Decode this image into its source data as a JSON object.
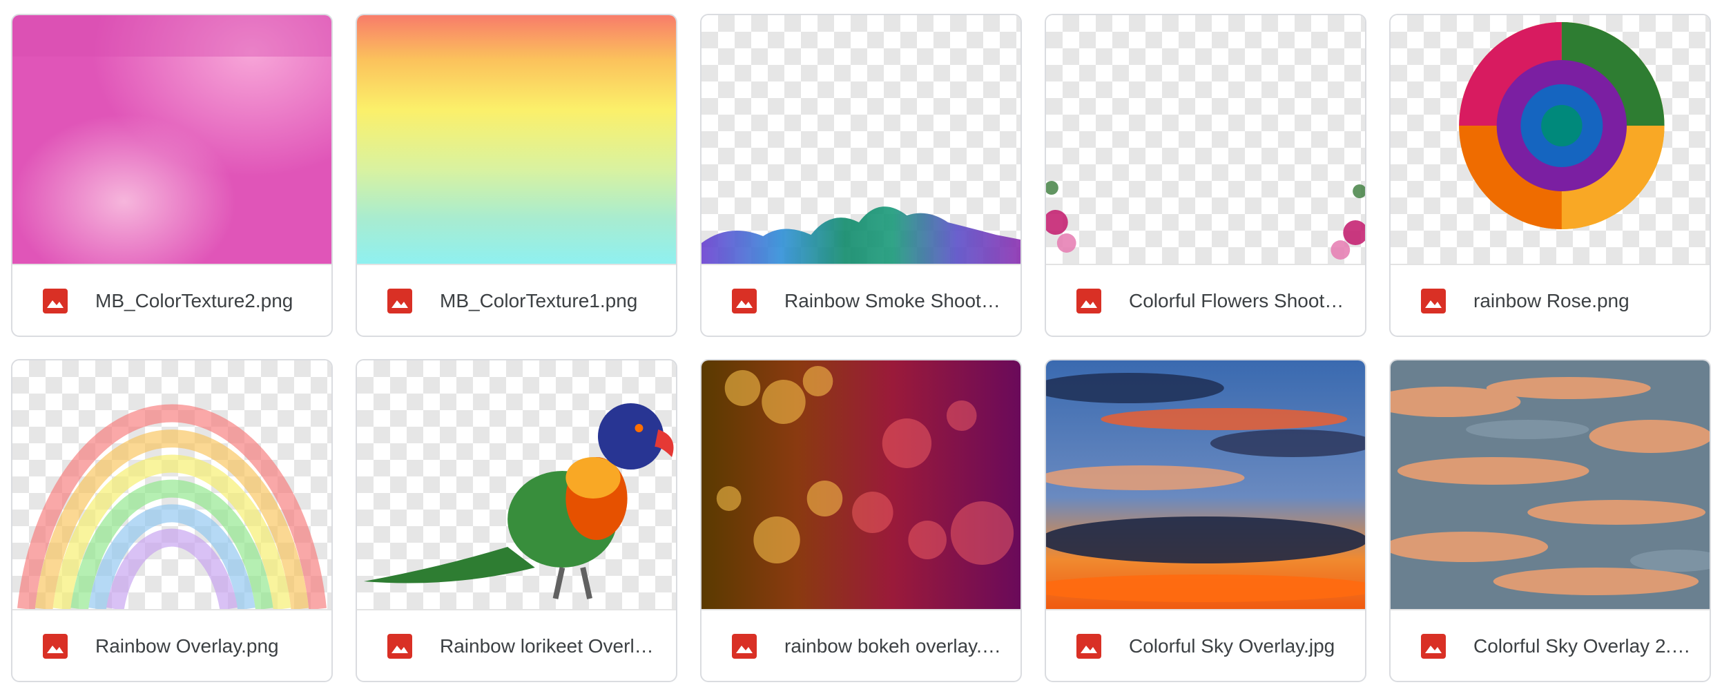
{
  "files": [
    {
      "name": "MB_ColorTexture2.png",
      "icon": "image-icon"
    },
    {
      "name": "MB_ColorTexture1.png",
      "icon": "image-icon"
    },
    {
      "name": "Rainbow Smoke Shoot…",
      "icon": "image-icon"
    },
    {
      "name": "Colorful Flowers Shoot…",
      "icon": "image-icon"
    },
    {
      "name": "rainbow Rose.png",
      "icon": "image-icon"
    },
    {
      "name": "Rainbow Overlay.png",
      "icon": "image-icon"
    },
    {
      "name": "Rainbow lorikeet Overl…",
      "icon": "image-icon"
    },
    {
      "name": "rainbow bokeh overlay.…",
      "icon": "image-icon"
    },
    {
      "name": "Colorful Sky Overlay.jpg",
      "icon": "image-icon"
    },
    {
      "name": "Colorful Sky Overlay 2.…",
      "icon": "image-icon"
    }
  ],
  "colors": {
    "file_icon": "#d93025",
    "caption_text": "#3c4043",
    "card_border": "#dadce0"
  }
}
